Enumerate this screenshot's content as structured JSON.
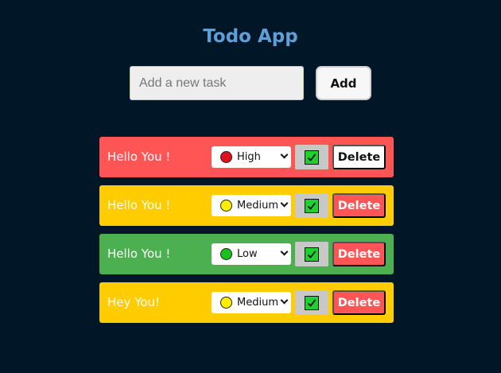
{
  "app": {
    "title": "Todo App"
  },
  "form": {
    "placeholder": "Add a new task",
    "value": "",
    "add_label": "Add"
  },
  "colors": {
    "high": "#ff5555",
    "medium": "#ffcc00",
    "low": "#4caf50",
    "dot_high": "#e0101c",
    "dot_medium": "#ffee00",
    "dot_low": "#18c21c"
  },
  "todos": [
    {
      "text": "Hello You !",
      "priority": "High",
      "level": "high",
      "completed": true,
      "delete_label": "Delete",
      "delete_style": "light"
    },
    {
      "text": "Hello You !",
      "priority": "Medium",
      "level": "medium",
      "completed": true,
      "delete_label": "Delete",
      "delete_style": "red"
    },
    {
      "text": "Hello You !",
      "priority": "Low",
      "level": "low",
      "completed": true,
      "delete_label": "Delete",
      "delete_style": "red"
    },
    {
      "text": "Hey You!",
      "priority": "Medium",
      "level": "medium",
      "completed": true,
      "delete_label": "Delete",
      "delete_style": "red"
    }
  ]
}
